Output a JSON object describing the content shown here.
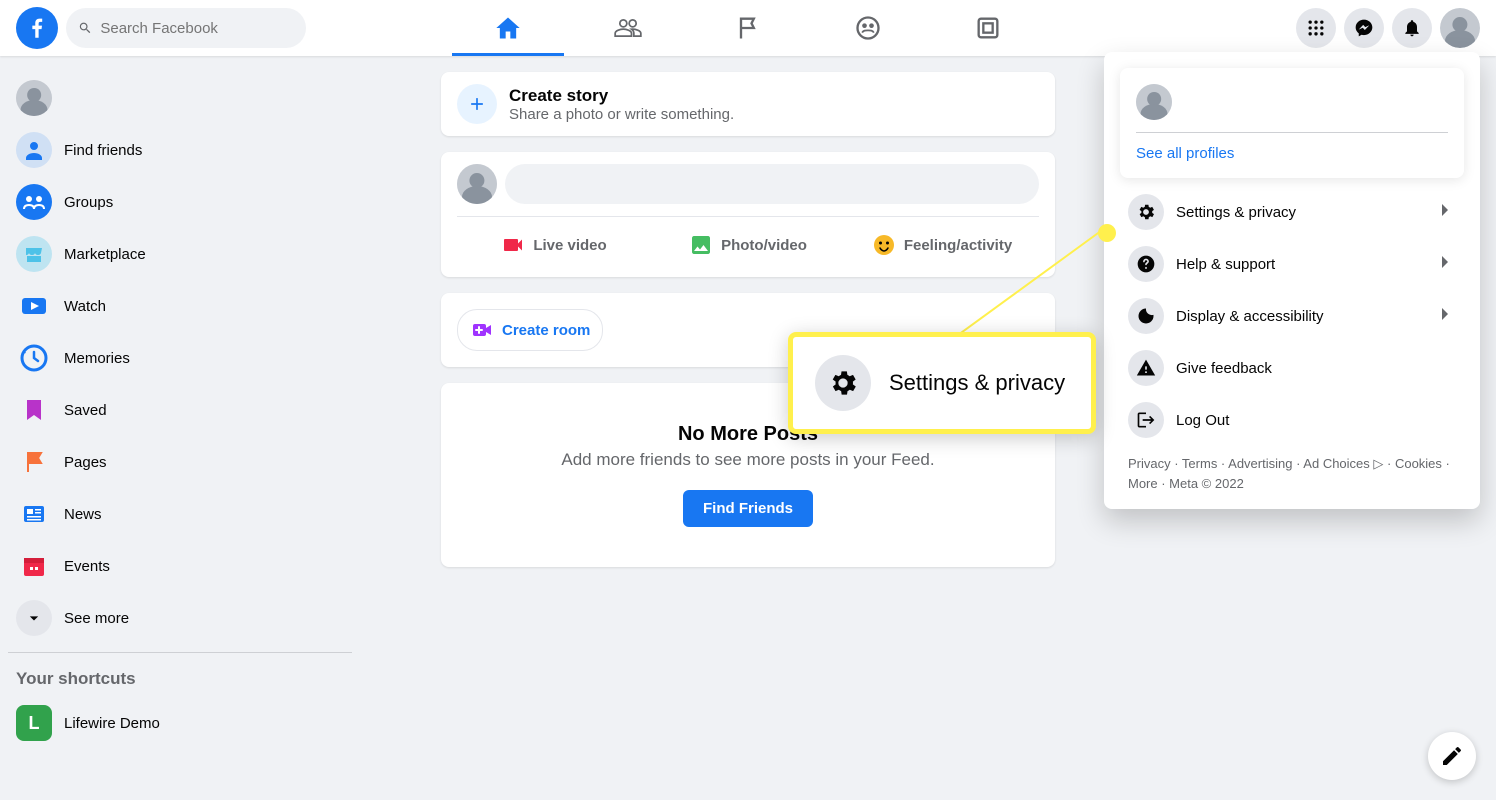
{
  "search": {
    "placeholder": "Search Facebook"
  },
  "sidebar": {
    "items": [
      {
        "label": "Find friends"
      },
      {
        "label": "Groups"
      },
      {
        "label": "Marketplace"
      },
      {
        "label": "Watch"
      },
      {
        "label": "Memories"
      },
      {
        "label": "Saved"
      },
      {
        "label": "Pages"
      },
      {
        "label": "News"
      },
      {
        "label": "Events"
      },
      {
        "label": "See more"
      }
    ],
    "shortcuts_heading": "Your shortcuts",
    "shortcuts": [
      {
        "label": "Lifewire Demo",
        "initial": "L"
      }
    ]
  },
  "create_story": {
    "title": "Create story",
    "subtitle": "Share a photo or write something."
  },
  "composer": {
    "actions": [
      {
        "label": "Live video"
      },
      {
        "label": "Photo/video"
      },
      {
        "label": "Feeling/activity"
      }
    ]
  },
  "create_room": {
    "label": "Create room"
  },
  "no_posts": {
    "title": "No More Posts",
    "subtitle": "Add more friends to see more posts in your Feed.",
    "button": "Find Friends"
  },
  "account_menu": {
    "see_all": "See all profiles",
    "items": [
      {
        "label": "Settings & privacy",
        "chevron": true
      },
      {
        "label": "Help & support",
        "chevron": true
      },
      {
        "label": "Display & accessibility",
        "chevron": true
      },
      {
        "label": "Give feedback",
        "chevron": false
      },
      {
        "label": "Log Out",
        "chevron": false
      }
    ],
    "footer": "Privacy · Terms · Advertising · Ad Choices ▷ · Cookies · More · Meta © 2022"
  },
  "callout": {
    "label": "Settings & privacy"
  }
}
